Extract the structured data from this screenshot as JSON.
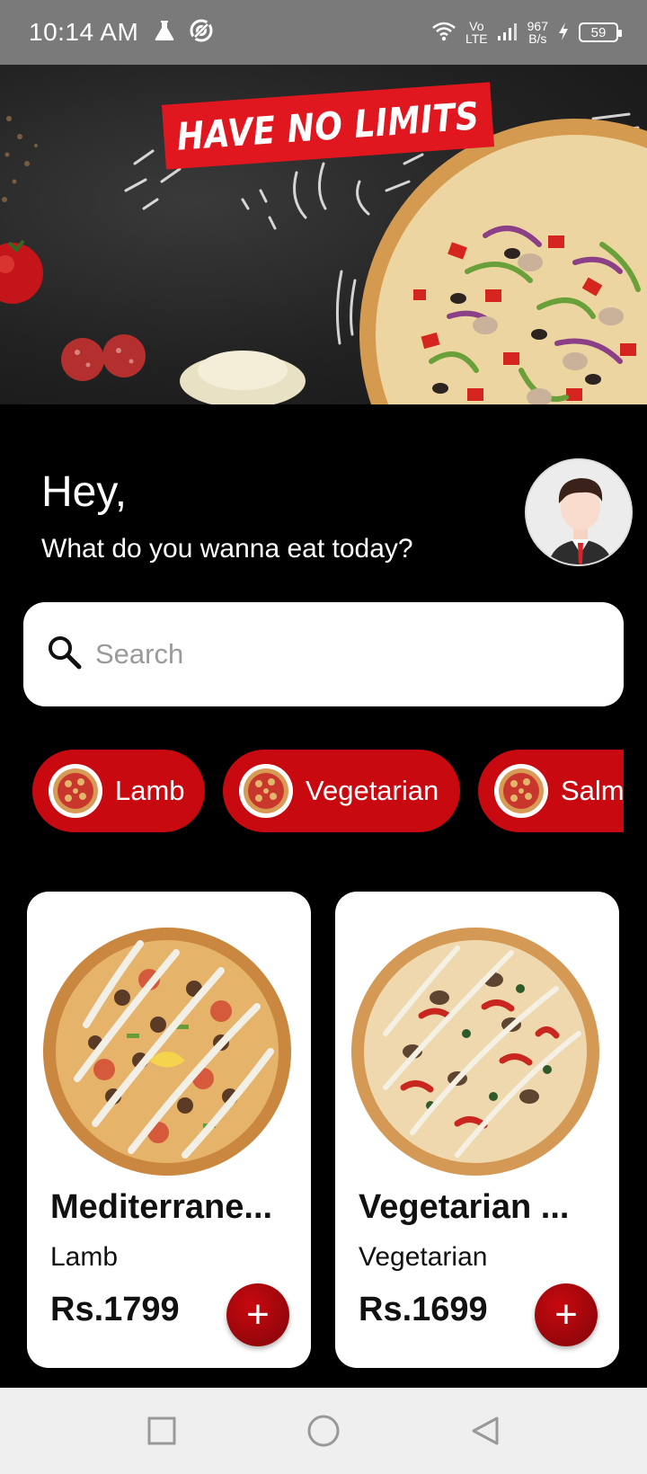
{
  "status_bar": {
    "time": "10:14 AM",
    "network_speed_value": "967",
    "network_speed_unit": "B/s",
    "network_type_top": "Vo",
    "network_type_bottom": "LTE",
    "battery": "59"
  },
  "banner": {
    "tagline": "HAVE NO LIMITS"
  },
  "greeting": {
    "title": "Hey,",
    "subtitle": "What do you wanna eat today?"
  },
  "search": {
    "placeholder": "Search"
  },
  "categories": [
    {
      "label": "Lamb"
    },
    {
      "label": "Vegetarian"
    },
    {
      "label": "Salm"
    }
  ],
  "products": [
    {
      "name": "Mediterrane...",
      "category": "Lamb",
      "price": "Rs.1799",
      "add_label": "+"
    },
    {
      "name": "Vegetarian ...",
      "category": "Vegetarian",
      "price": "Rs.1699",
      "add_label": "+"
    }
  ],
  "colors": {
    "accent": "#c8090f",
    "status_bar": "#7a7a7a",
    "background": "#000000"
  },
  "icons": [
    "flask-icon",
    "data-saver-icon",
    "wifi-icon",
    "signal-icon",
    "charging-icon",
    "battery-icon",
    "search-icon",
    "pizza-icon",
    "plus-icon",
    "square-nav-icon",
    "circle-nav-icon",
    "triangle-back-icon"
  ]
}
